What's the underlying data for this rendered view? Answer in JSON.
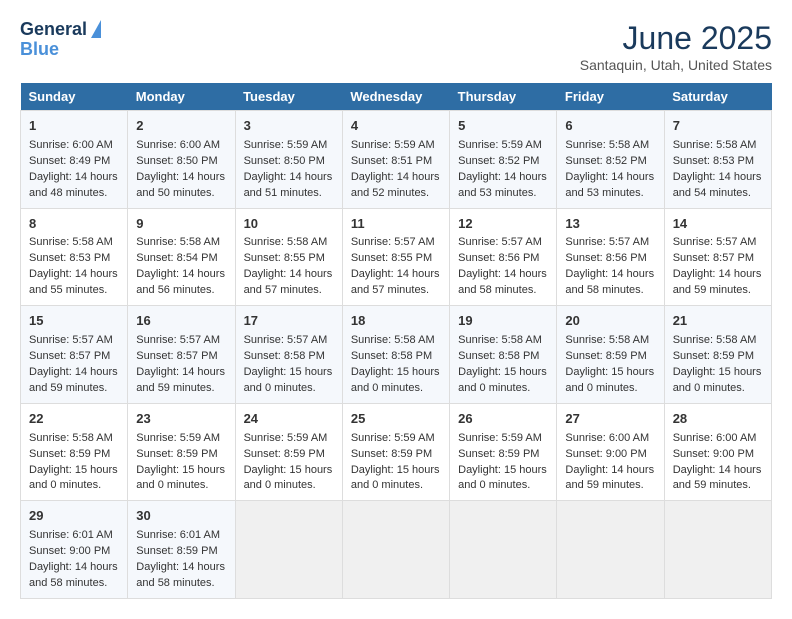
{
  "header": {
    "logo_line1": "General",
    "logo_line2": "Blue",
    "title": "June 2025",
    "subtitle": "Santaquin, Utah, United States"
  },
  "days_of_week": [
    "Sunday",
    "Monday",
    "Tuesday",
    "Wednesday",
    "Thursday",
    "Friday",
    "Saturday"
  ],
  "weeks": [
    [
      {
        "day": "1",
        "info": "Sunrise: 6:00 AM\nSunset: 8:49 PM\nDaylight: 14 hours\nand 48 minutes."
      },
      {
        "day": "2",
        "info": "Sunrise: 6:00 AM\nSunset: 8:50 PM\nDaylight: 14 hours\nand 50 minutes."
      },
      {
        "day": "3",
        "info": "Sunrise: 5:59 AM\nSunset: 8:50 PM\nDaylight: 14 hours\nand 51 minutes."
      },
      {
        "day": "4",
        "info": "Sunrise: 5:59 AM\nSunset: 8:51 PM\nDaylight: 14 hours\nand 52 minutes."
      },
      {
        "day": "5",
        "info": "Sunrise: 5:59 AM\nSunset: 8:52 PM\nDaylight: 14 hours\nand 53 minutes."
      },
      {
        "day": "6",
        "info": "Sunrise: 5:58 AM\nSunset: 8:52 PM\nDaylight: 14 hours\nand 53 minutes."
      },
      {
        "day": "7",
        "info": "Sunrise: 5:58 AM\nSunset: 8:53 PM\nDaylight: 14 hours\nand 54 minutes."
      }
    ],
    [
      {
        "day": "8",
        "info": "Sunrise: 5:58 AM\nSunset: 8:53 PM\nDaylight: 14 hours\nand 55 minutes."
      },
      {
        "day": "9",
        "info": "Sunrise: 5:58 AM\nSunset: 8:54 PM\nDaylight: 14 hours\nand 56 minutes."
      },
      {
        "day": "10",
        "info": "Sunrise: 5:58 AM\nSunset: 8:55 PM\nDaylight: 14 hours\nand 57 minutes."
      },
      {
        "day": "11",
        "info": "Sunrise: 5:57 AM\nSunset: 8:55 PM\nDaylight: 14 hours\nand 57 minutes."
      },
      {
        "day": "12",
        "info": "Sunrise: 5:57 AM\nSunset: 8:56 PM\nDaylight: 14 hours\nand 58 minutes."
      },
      {
        "day": "13",
        "info": "Sunrise: 5:57 AM\nSunset: 8:56 PM\nDaylight: 14 hours\nand 58 minutes."
      },
      {
        "day": "14",
        "info": "Sunrise: 5:57 AM\nSunset: 8:57 PM\nDaylight: 14 hours\nand 59 minutes."
      }
    ],
    [
      {
        "day": "15",
        "info": "Sunrise: 5:57 AM\nSunset: 8:57 PM\nDaylight: 14 hours\nand 59 minutes."
      },
      {
        "day": "16",
        "info": "Sunrise: 5:57 AM\nSunset: 8:57 PM\nDaylight: 14 hours\nand 59 minutes."
      },
      {
        "day": "17",
        "info": "Sunrise: 5:57 AM\nSunset: 8:58 PM\nDaylight: 15 hours\nand 0 minutes."
      },
      {
        "day": "18",
        "info": "Sunrise: 5:58 AM\nSunset: 8:58 PM\nDaylight: 15 hours\nand 0 minutes."
      },
      {
        "day": "19",
        "info": "Sunrise: 5:58 AM\nSunset: 8:58 PM\nDaylight: 15 hours\nand 0 minutes."
      },
      {
        "day": "20",
        "info": "Sunrise: 5:58 AM\nSunset: 8:59 PM\nDaylight: 15 hours\nand 0 minutes."
      },
      {
        "day": "21",
        "info": "Sunrise: 5:58 AM\nSunset: 8:59 PM\nDaylight: 15 hours\nand 0 minutes."
      }
    ],
    [
      {
        "day": "22",
        "info": "Sunrise: 5:58 AM\nSunset: 8:59 PM\nDaylight: 15 hours\nand 0 minutes."
      },
      {
        "day": "23",
        "info": "Sunrise: 5:59 AM\nSunset: 8:59 PM\nDaylight: 15 hours\nand 0 minutes."
      },
      {
        "day": "24",
        "info": "Sunrise: 5:59 AM\nSunset: 8:59 PM\nDaylight: 15 hours\nand 0 minutes."
      },
      {
        "day": "25",
        "info": "Sunrise: 5:59 AM\nSunset: 8:59 PM\nDaylight: 15 hours\nand 0 minutes."
      },
      {
        "day": "26",
        "info": "Sunrise: 5:59 AM\nSunset: 8:59 PM\nDaylight: 15 hours\nand 0 minutes."
      },
      {
        "day": "27",
        "info": "Sunrise: 6:00 AM\nSunset: 9:00 PM\nDaylight: 14 hours\nand 59 minutes."
      },
      {
        "day": "28",
        "info": "Sunrise: 6:00 AM\nSunset: 9:00 PM\nDaylight: 14 hours\nand 59 minutes."
      }
    ],
    [
      {
        "day": "29",
        "info": "Sunrise: 6:01 AM\nSunset: 9:00 PM\nDaylight: 14 hours\nand 58 minutes."
      },
      {
        "day": "30",
        "info": "Sunrise: 6:01 AM\nSunset: 8:59 PM\nDaylight: 14 hours\nand 58 minutes."
      },
      {
        "day": "",
        "info": ""
      },
      {
        "day": "",
        "info": ""
      },
      {
        "day": "",
        "info": ""
      },
      {
        "day": "",
        "info": ""
      },
      {
        "day": "",
        "info": ""
      }
    ]
  ]
}
